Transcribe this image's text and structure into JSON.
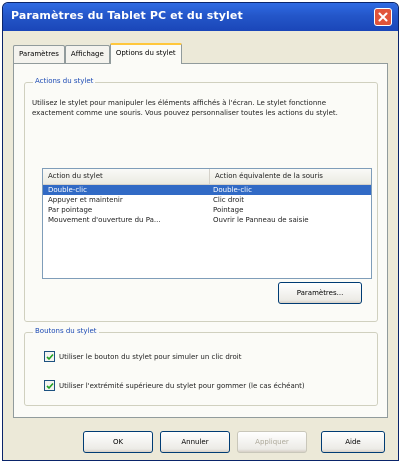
{
  "window": {
    "title": "Paramètres du Tablet PC et du stylet"
  },
  "tabs": [
    {
      "label": "Paramètres",
      "active": false
    },
    {
      "label": "Affichage",
      "active": false
    },
    {
      "label": "Options du stylet",
      "active": true
    }
  ],
  "actions_group": {
    "legend": "Actions du stylet",
    "description": "Utilisez le stylet pour manipuler les éléments affichés à l'écran. Le stylet fonctionne exactement comme une souris. Vous pouvez personnaliser toutes les actions du stylet.",
    "columns": [
      "Action du stylet",
      "Action équivalente de la souris"
    ],
    "rows": [
      {
        "action": "Double-clic",
        "equivalent": "Double-clic",
        "selected": true
      },
      {
        "action": "Appuyer et maintenir",
        "equivalent": "Clic droit",
        "selected": false
      },
      {
        "action": "Par pointage",
        "equivalent": "Pointage",
        "selected": false
      },
      {
        "action": "Mouvement d'ouverture du Pa...",
        "equivalent": "Ouvrir le Panneau de saisie",
        "selected": false
      }
    ],
    "settings_button": "Paramètres..."
  },
  "buttons_group": {
    "legend": "Boutons du stylet",
    "options": [
      {
        "label": "Utiliser le bouton du stylet pour simuler un clic droit",
        "checked": true
      },
      {
        "label": "Utiliser l'extrémité supérieure du stylet pour gommer (le cas échéant)",
        "checked": true
      }
    ]
  },
  "footer": {
    "ok": "OK",
    "cancel": "Annuler",
    "apply": "Appliquer",
    "help": "Aide"
  },
  "colors": {
    "titlebar": "#2456c9",
    "selection": "#316ac5",
    "active_tab_accent": "#ffc73c",
    "close_button": "#e1543a"
  }
}
